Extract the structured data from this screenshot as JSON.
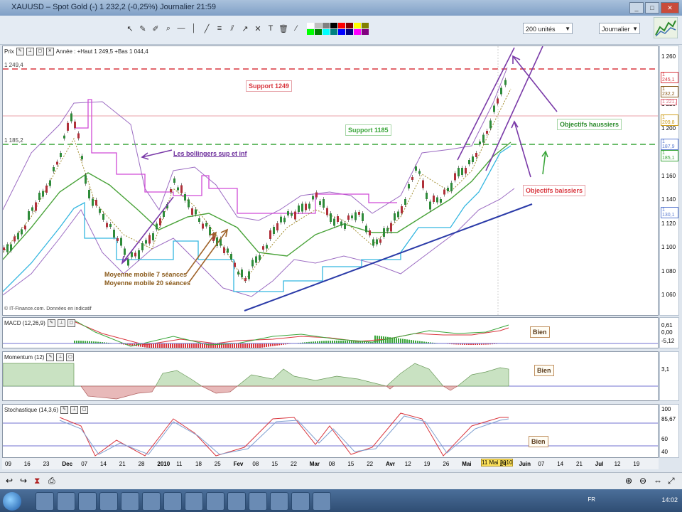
{
  "window": {
    "title": "XAUUSD – Spot Gold (-)  1 232,2 (-0,25%)  Journalier 21:59"
  },
  "toolbar": {
    "units_select": "200 unités",
    "period_select": "Journalier"
  },
  "colors": {
    "swatches": [
      "#ffffff",
      "#c0c0c0",
      "#808080",
      "#000000",
      "#ff0000",
      "#800000",
      "#ffff00",
      "#808000",
      "#00ff00",
      "#008000",
      "#00ffff",
      "#008080",
      "#0000ff",
      "#000080",
      "#ff00ff",
      "#800080"
    ]
  },
  "price_panel": {
    "header_name": "Prix",
    "header_info": "Année : +Haut 1 249,5 +Bas 1 044,4",
    "level_high": "1 249,4",
    "level_low": "1 185,2",
    "copyright": "© IT-Finance.com. Données en indicatif",
    "annotations": {
      "support_1249": "Support 1249",
      "support_1185": "Support 1185",
      "bollingers": "Les bollingers sup et inf",
      "objectifs_haussiers": "Objectifs haussiers",
      "objectifs_baissiers": "Objectifs baissiers",
      "mm7": "Moyenne mobile 7 séances",
      "mm20": "Moyenne mobile 20 séances"
    },
    "y_ticks": [
      "1 260",
      "1 240",
      "1 220",
      "1 200",
      "1 180",
      "1 160",
      "1 140",
      "1 120",
      "1 100",
      "1 080",
      "1 060"
    ],
    "price_labels": [
      "1 245,1",
      "1 232,2",
      "1 221,",
      "1 209,8",
      "1 187,9",
      "1 185,1",
      "1 130,1"
    ]
  },
  "macd_panel": {
    "header_name": "MACD (12,26,9)",
    "badge": "Bien",
    "scale": [
      "0,61",
      "0,00",
      "-5,12"
    ]
  },
  "momentum_panel": {
    "header_name": "Momentum (12)",
    "badge": "Bien",
    "scale": [
      "3,1"
    ]
  },
  "stochastic_panel": {
    "header_name": "Stochastique (14,3,6)",
    "badge": "Bien",
    "scale": [
      "100",
      "85,67",
      "60",
      "40"
    ]
  },
  "x_axis": {
    "labels": [
      "09",
      "16",
      "23",
      "Dec",
      "07",
      "14",
      "21",
      "28",
      "2010",
      "11",
      "18",
      "25",
      "Fev",
      "08",
      "15",
      "22",
      "Mar",
      "08",
      "15",
      "22",
      "Avr",
      "12",
      "19",
      "26",
      "Mai",
      "11 Mai 2010",
      "24",
      "Juin",
      "07",
      "14",
      "21",
      "Jul",
      "12",
      "19"
    ]
  },
  "taskbar": {
    "language": "FR",
    "clock": "14:02"
  }
}
